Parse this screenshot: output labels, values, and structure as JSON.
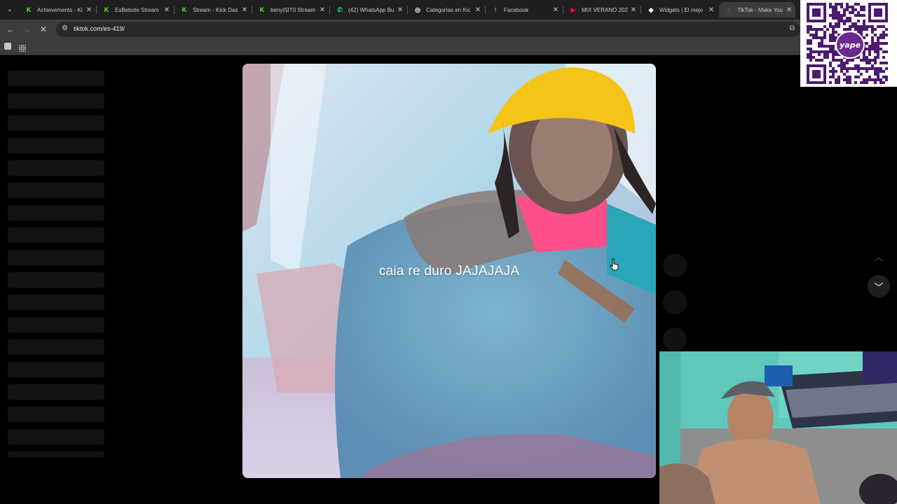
{
  "browser": {
    "tabs": [
      {
        "title": "Achievements - Ki",
        "favicon": "kick-icon",
        "color": "#53fc18",
        "glyph": "K"
      },
      {
        "title": "EsBebote Stream",
        "favicon": "kick-icon",
        "color": "#53fc18",
        "glyph": "K"
      },
      {
        "title": "Stream - Kick Das",
        "favicon": "kick-icon",
        "color": "#53fc18",
        "glyph": "K"
      },
      {
        "title": "benyiSIT0 Stream",
        "favicon": "kick-icon",
        "color": "#53fc18",
        "glyph": "K"
      },
      {
        "title": "(42) WhatsApp Bu",
        "favicon": "whatsapp-icon",
        "color": "#25d366",
        "glyph": "✆"
      },
      {
        "title": "Categorías en Kic",
        "favicon": "kick-icon",
        "color": "#ffffff",
        "glyph": "◎"
      },
      {
        "title": "Facebook",
        "favicon": "facebook-icon",
        "color": "#1877f2",
        "glyph": "f"
      },
      {
        "title": "MIX VERANO 202",
        "favicon": "youtube-icon",
        "color": "#ff0033",
        "glyph": "▶"
      },
      {
        "title": "Widgets | El mejo",
        "favicon": "widget-icon",
        "color": "#ffffff",
        "glyph": "◆"
      },
      {
        "title": "TikTok - Make You",
        "favicon": "tiktok-icon",
        "color": "#c4c7c5",
        "glyph": "◌",
        "active": true
      }
    ],
    "url": "tiktok.com/es-419/"
  },
  "video": {
    "caption": "caia re duro JAJAJAJA"
  },
  "overlay": {
    "qr_brand": "yape"
  },
  "colors": {
    "accent": "#53fc18",
    "background": "#000000"
  }
}
